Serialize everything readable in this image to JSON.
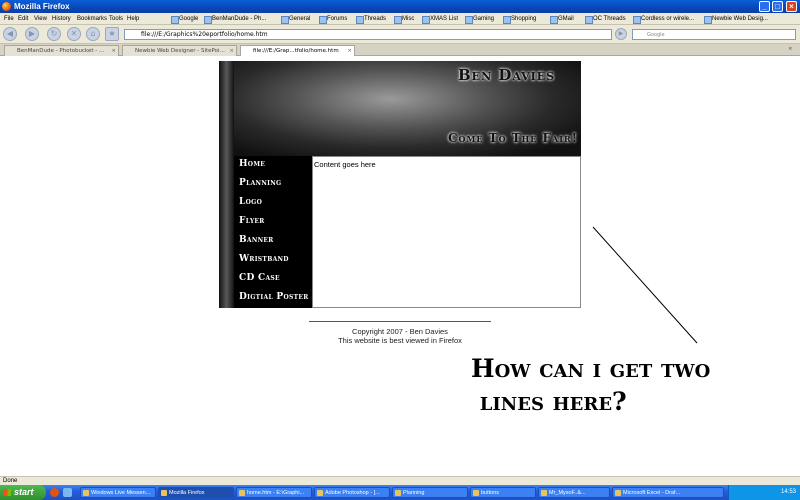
{
  "window": {
    "title": "Mozilla Firefox",
    "buttons": [
      "_",
      "□",
      "×"
    ]
  },
  "menubar": {
    "menus": [
      "File",
      "Edit",
      "View",
      "History",
      "Bookmarks",
      "Tools",
      "Help"
    ],
    "bookmarks": [
      "Google",
      "BenManDude - Ph...",
      "General",
      "Forums",
      "Threads",
      "Misc",
      "XMAS List",
      "Gaming",
      "Shopping",
      "GMail",
      "OC Threads",
      "Cordless or wirele...",
      "Newbie Web Desig..."
    ]
  },
  "navbar": {
    "url": "file:///E:/Graphics%20eportfolio/home.htm",
    "search_placeholder": "Google",
    "icons": [
      "back-icon",
      "forward-icon",
      "reload-icon",
      "stop-icon",
      "home-icon",
      "bookmark-add-icon"
    ]
  },
  "tabs": [
    {
      "label": "BenManDude - Photobucket - ...",
      "active": false
    },
    {
      "label": "Newbie Web Designer - SitePoi...",
      "active": false
    },
    {
      "label": "file:///E:/Grap...tfolio/home.htm",
      "active": true
    }
  ],
  "site": {
    "name": "Ben Davies",
    "slogan": "Come To The Fair!",
    "nav": [
      "Home",
      "Planning",
      "Logo",
      "Flyer",
      "Banner",
      "Wristband",
      "CD Case",
      "Digtial Poster"
    ],
    "content": "Content goes here",
    "footer": {
      "copyright": "Copyright 2007 - Ben Davies",
      "note": "This website is best viewed in Firefox"
    }
  },
  "annotation": {
    "line1": "How can i get two",
    "line2": " lines here?"
  },
  "statusbar": {
    "text": "Done"
  },
  "taskbar": {
    "start_label": "start",
    "items": [
      {
        "label": "Windows Live Messen...",
        "active": false
      },
      {
        "label": "Mozilla Firefox",
        "active": true
      },
      {
        "label": "home.htm - E:\\Graphi...",
        "active": false
      },
      {
        "label": "Adobe Photoshop - [...",
        "active": false
      },
      {
        "label": "Planning",
        "active": false
      },
      {
        "label": "buttons",
        "active": false
      },
      {
        "label": "Mr_MysoF..&...",
        "active": false
      },
      {
        "label": "Microsoft Excel - Draf...",
        "active": false
      }
    ],
    "clock": "14:53"
  }
}
